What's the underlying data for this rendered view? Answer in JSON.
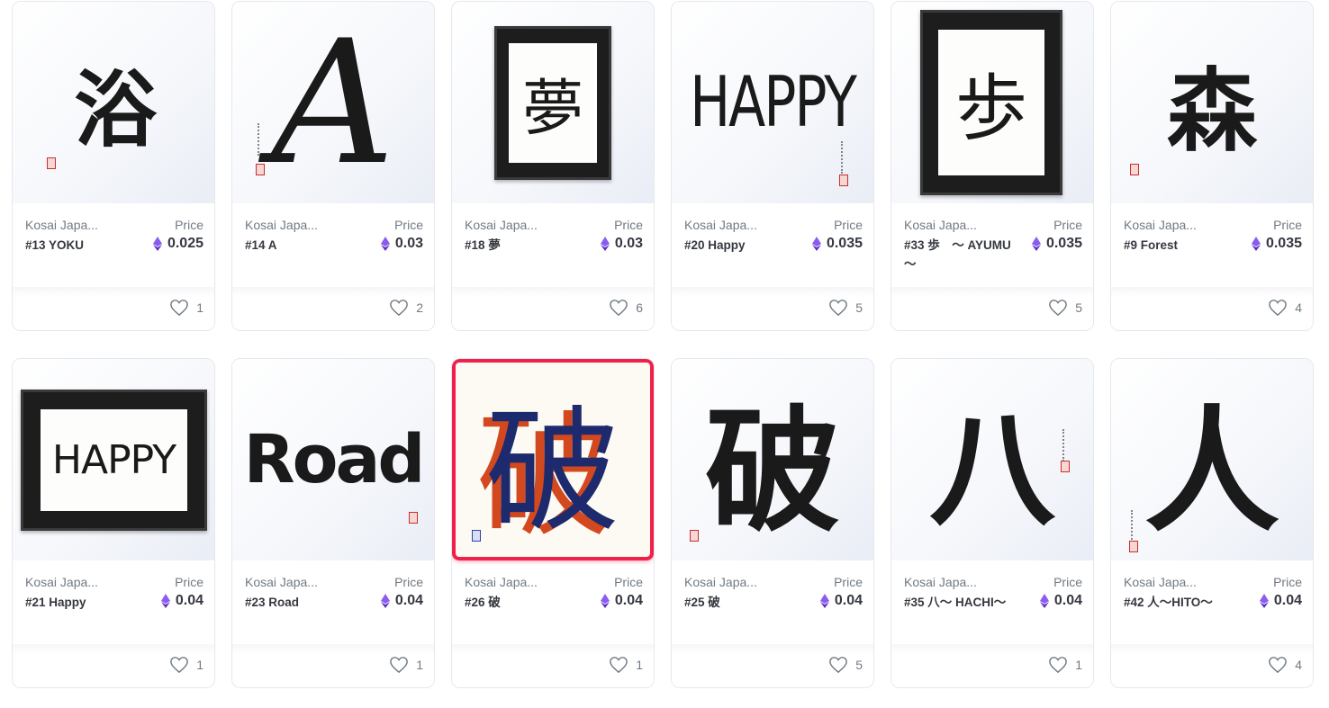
{
  "colors": {
    "text": "#353840",
    "muted": "#707a83",
    "eth": "#7b3fe4",
    "highlight": "#f0204a",
    "border": "#e5e8eb"
  },
  "icons": {
    "currency": "ethereum-icon",
    "favorite": "heart-icon"
  },
  "cards": [
    {
      "creator": "Kosai Japa...",
      "price_label": "Price",
      "title": "#13 YOKU",
      "price": "0.025",
      "likes": "1",
      "art_text": "浴",
      "art_style": "plain"
    },
    {
      "creator": "Kosai Japa...",
      "price_label": "Price",
      "title": "#14 A",
      "price": "0.03",
      "likes": "2",
      "art_text": "A",
      "art_style": "plain"
    },
    {
      "creator": "Kosai Japa...",
      "price_label": "Price",
      "title": "#18 夢",
      "price": "0.03",
      "likes": "6",
      "art_text": "夢",
      "art_style": "framed"
    },
    {
      "creator": "Kosai Japa...",
      "price_label": "Price",
      "title": "#20 Happy",
      "price": "0.035",
      "likes": "5",
      "art_text": "HAPPY",
      "art_style": "plain"
    },
    {
      "creator": "Kosai Japa...",
      "price_label": "Price",
      "title": "#33 歩　～ AYUMU～",
      "price": "0.035",
      "likes": "5",
      "art_text": "歩",
      "art_style": "framed-tall"
    },
    {
      "creator": "Kosai Japa...",
      "price_label": "Price",
      "title": "#9 Forest",
      "price": "0.035",
      "likes": "4",
      "art_text": "森",
      "art_style": "plain"
    },
    {
      "creator": "Kosai Japa...",
      "price_label": "Price",
      "title": "#21 Happy",
      "price": "0.04",
      "likes": "1",
      "art_text": "HAPPY",
      "art_style": "framed-wide"
    },
    {
      "creator": "Kosai Japa...",
      "price_label": "Price",
      "title": "#23 Road",
      "price": "0.04",
      "likes": "1",
      "art_text": "Road",
      "art_style": "plain"
    },
    {
      "creator": "Kosai Japa...",
      "price_label": "Price",
      "title": "#26 破",
      "price": "0.04",
      "likes": "1",
      "art_text": "破",
      "art_style": "highlight"
    },
    {
      "creator": "Kosai Japa...",
      "price_label": "Price",
      "title": "#25 破",
      "price": "0.04",
      "likes": "5",
      "art_text": "破",
      "art_style": "plain"
    },
    {
      "creator": "Kosai Japa...",
      "price_label": "Price",
      "title": "#35 八～ HACHI～",
      "price": "0.04",
      "likes": "1",
      "art_text": "八",
      "art_style": "plain"
    },
    {
      "creator": "Kosai Japa...",
      "price_label": "Price",
      "title": "#42 人～HITO～",
      "price": "0.04",
      "likes": "4",
      "art_text": "人",
      "art_style": "plain"
    }
  ]
}
